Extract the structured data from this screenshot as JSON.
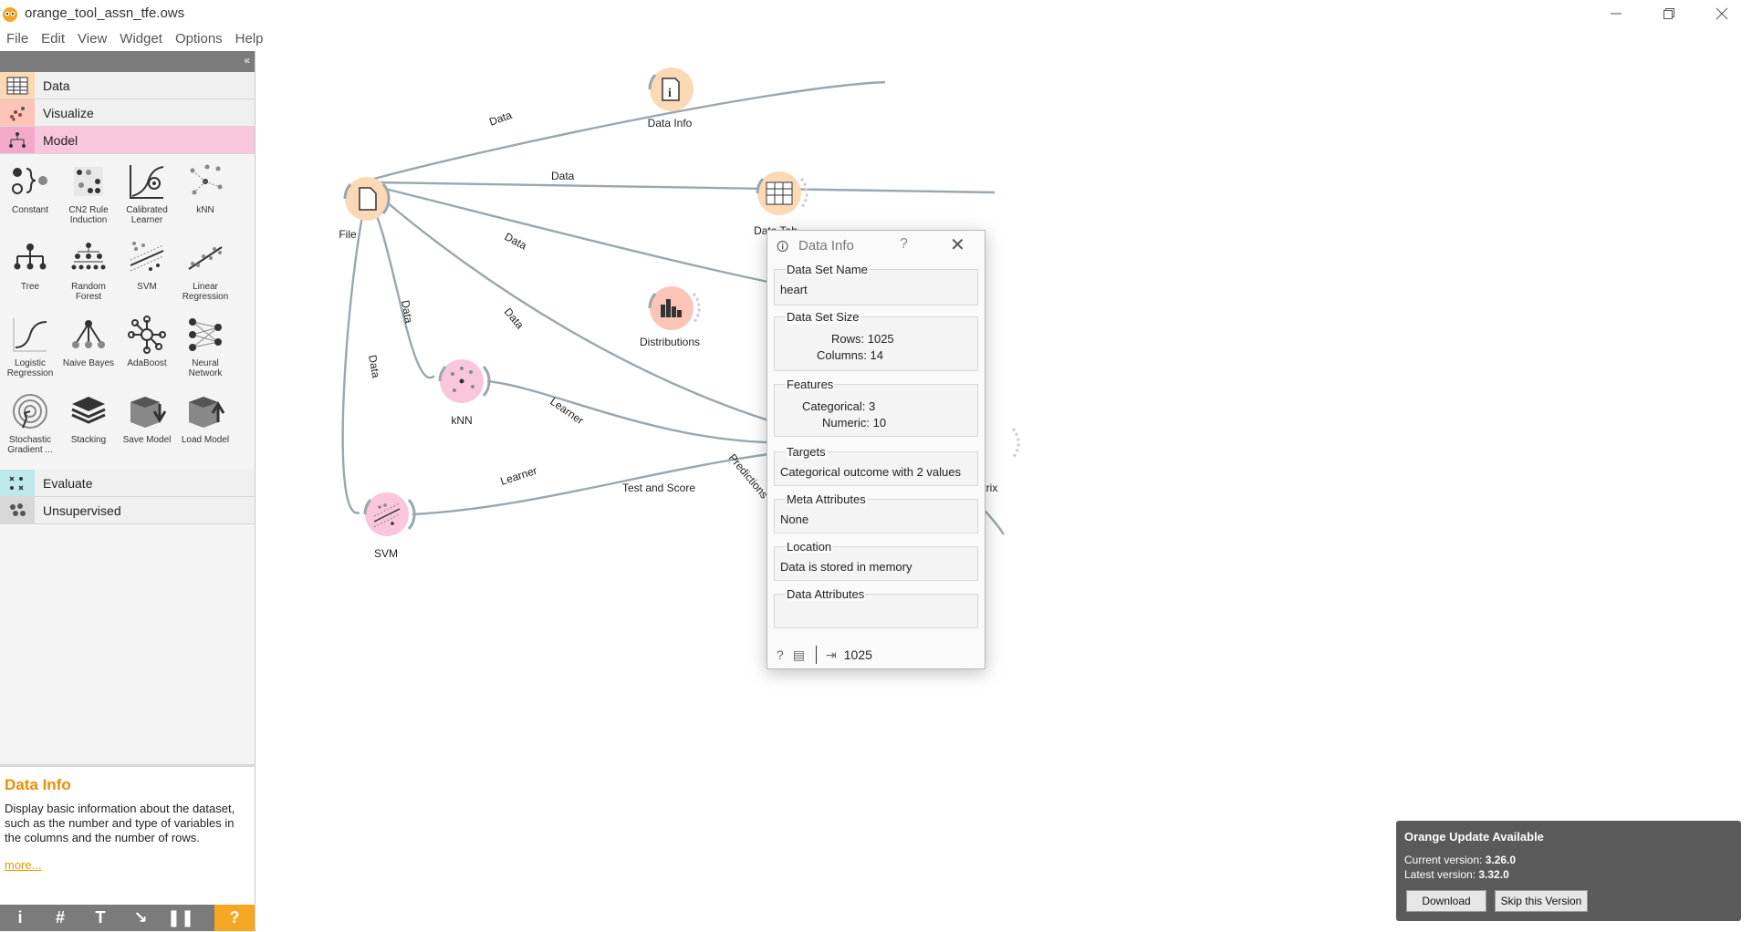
{
  "window": {
    "title": "orange_tool_assn_tfe.ows"
  },
  "menu": [
    "File",
    "Edit",
    "View",
    "Widget",
    "Options",
    "Help"
  ],
  "toolbox": {
    "categories": {
      "data": "Data",
      "visualize": "Visualize",
      "model": "Model",
      "evaluate": "Evaluate",
      "unsupervised": "Unsupervised"
    },
    "model_widgets": [
      {
        "label": "Constant",
        "icon": "constant-icon"
      },
      {
        "label": "CN2 Rule Induction",
        "icon": "cn2-rule-induction-icon"
      },
      {
        "label": "Calibrated Learner",
        "icon": "calibrated-learner-icon"
      },
      {
        "label": "kNN",
        "icon": "knn-icon"
      },
      {
        "label": "Tree",
        "icon": "tree-icon"
      },
      {
        "label": "Random Forest",
        "icon": "random-forest-icon"
      },
      {
        "label": "SVM",
        "icon": "svm-icon"
      },
      {
        "label": "Linear Regression",
        "icon": "linear-regression-icon"
      },
      {
        "label": "Logistic Regression",
        "icon": "logistic-regression-icon"
      },
      {
        "label": "Naive Bayes",
        "icon": "naive-bayes-icon"
      },
      {
        "label": "AdaBoost",
        "icon": "adaboost-icon"
      },
      {
        "label": "Neural Network",
        "icon": "neural-network-icon"
      },
      {
        "label": "Stochastic Gradient ...",
        "icon": "stochastic-gradient-icon"
      },
      {
        "label": "Stacking",
        "icon": "stacking-icon"
      },
      {
        "label": "Save Model",
        "icon": "save-model-icon"
      },
      {
        "label": "Load Model",
        "icon": "load-model-icon"
      }
    ]
  },
  "help_panel": {
    "title": "Data Info",
    "text": "Display basic information about the dataset, such as the number and type of variables in the columns and the number of rows.",
    "more": "more..."
  },
  "canvas": {
    "nodes": {
      "file": "File",
      "data_info": "Data Info",
      "data_table": "Data Tab",
      "distributions": "Distributions",
      "knn": "kNN",
      "svm": "SVM",
      "test_and_score": "Test and Score",
      "confusion_matrix": "atrix"
    },
    "links": {
      "data": "Data",
      "learner": "Learner",
      "predictions": "Predictions"
    }
  },
  "dialog": {
    "title": "Data Info",
    "help": "?",
    "data_set_name": {
      "title": "Data Set Name",
      "value": "heart"
    },
    "data_set_size": {
      "title": "Data Set Size",
      "rows": "Rows: 1025",
      "columns": "Columns: 14"
    },
    "features": {
      "title": "Features",
      "categorical": "Categorical: 3",
      "numeric": "Numeric: 10"
    },
    "targets": {
      "title": "Targets",
      "value": "Categorical outcome with 2 values"
    },
    "meta": {
      "title": "Meta Attributes",
      "value": "None"
    },
    "location": {
      "title": "Location",
      "value": "Data is stored in memory"
    },
    "attributes": {
      "title": "Data Attributes"
    },
    "footer_count": "1025"
  },
  "update": {
    "title": "Orange Update Available",
    "current_label": "Current version: ",
    "current": "3.26.0",
    "latest_label": "Latest version: ",
    "latest": "3.32.0",
    "download": "Download",
    "skip": "Skip this Version"
  }
}
